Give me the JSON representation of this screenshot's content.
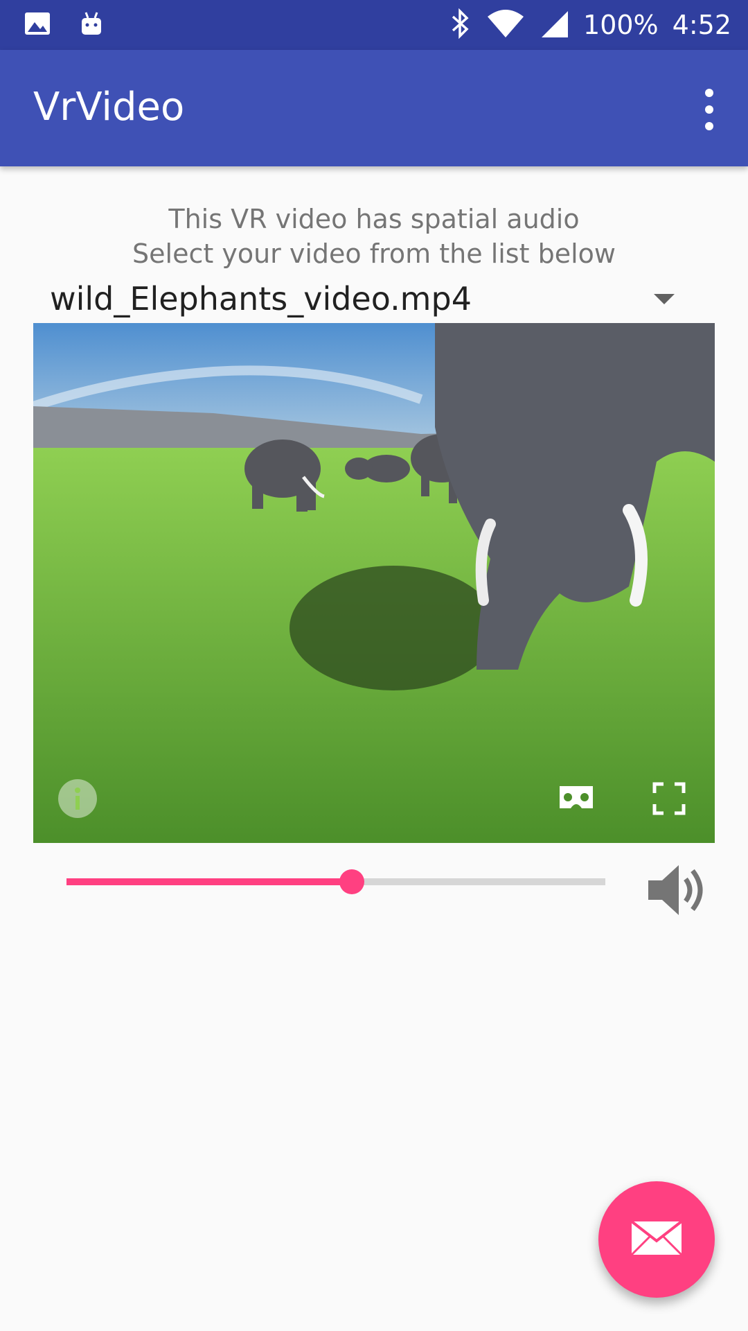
{
  "status_bar": {
    "battery": "100%",
    "time": "4:52",
    "icons": [
      "image-icon",
      "android-icon",
      "bluetooth-icon",
      "wifi-icon",
      "signal-icon"
    ]
  },
  "app_bar": {
    "title": "VrVideo",
    "menu_icon": "overflow-menu-icon"
  },
  "content": {
    "line1": "This VR video has spatial audio",
    "line2": "Select your video from the list below",
    "selected_video": "wild_Elephants_video.mp4"
  },
  "player": {
    "info_icon": "info-icon",
    "cardboard_icon": "cardboard-icon",
    "fullscreen_icon": "fullscreen-icon",
    "progress_fraction": 0.53,
    "volume_icon": "volume-icon"
  },
  "fab": {
    "icon": "mail-icon"
  },
  "colors": {
    "primary": "#3f51b5",
    "primary_dark": "#303f9f",
    "accent": "#ff4081"
  }
}
